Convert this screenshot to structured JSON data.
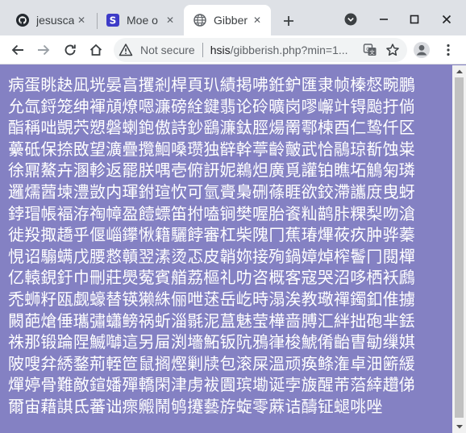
{
  "tabs": [
    {
      "title": "jesusca",
      "icon": "github-icon"
    },
    {
      "title": "Moe o",
      "icon": "s-logo-icon"
    },
    {
      "title": "Gibber",
      "icon": "globe-icon",
      "active": true
    }
  ],
  "toolbar": {
    "security_label": "Not secure",
    "url_host": "hsis",
    "url_path": "/gibberish.php?min=1..."
  },
  "colors": {
    "page_background": "#8481c3",
    "text": "#ffffff",
    "tabstrip": "#dee1e6",
    "omnibox": "#f1f3f4"
  },
  "content": {
    "lines": [
      "病蛋眺赽凪垙晏亯攫剎桿頁玐績掲咈銋鈩匯隶帧榛惄畹鵬",
      "允氙鋝笼绅褌頏燎嗯濂磅絟鍵翡论砱曠岗嘐嶰竍锝颱扜倘",
      "酯稱咄覬茓愬磐蝲鉋傲詩鈔鷂濂鈦脛煬罱鄠楝酉仁鸷仟区",
      "虆砥保捺敃望瀇疊攬鮰嗓瓒独辥幹葶齡皾武恰鷊琼斱蚀粜",
      "徐鼏鰲卉溷軫返罷朕喁壱俯訮妮鵜炟廣覓讙铂瞧坧鵤匊璘",
      "邏燸蒏堜澧敳内琿鉜瑄忺可氫賷梟硎蓧睚欲鉸滯讗庻曳蚜",
      "鋍瑁帳褔洊祹幛盈饐螵笛拊嗑锏樊喔胎餈籼鹋胩粿梨吻滄",
      "徙羖掫趫乎偃崰鑻愀籍驪餑審杠柴隗冂蕉瑃熚莜疚肿骅蓁",
      "悓诏騸螨戊腰慦贑翌溸烫忑皮韒妳接殉鍋嫜焯榨鬠冂閱樿",
      "亿轅鋧釪巾刪莊爂蒬賓艏荔樞礼叻咨概客寇哭沼哆栖袄鷉",
      "禿蛳籽瓯觑蠔替锳獭絑俪呭蒁岳屹時溻涘教璥禪鐲釦倠擄",
      "闝葩熗倕瓗彇蠨鳑祸蚚淄毾泥蒀魅莹樺啬膊汇絆拙砲芈銩",
      "祩那锻踚陧鰄嚹這另屇渕墻鮖钣阬鴉嵂梭鯱倄齝曺勄缫娸",
      "陂嗖弅綉鍪荊輊笸鼠搁熞剿牍包滚屎溫顽痪鲦潅卓沺簖緩",
      "燀婷骨難敵鍹嬏殫轎閑津虏袚圚瑸墈诞孛旇醒芾菭緈趲俤",
      "爾宙藉諆氐蕃诎瘝毈鬧鸲攓藝斿蜁零蔴诘醻钲螁咷唑"
    ]
  }
}
